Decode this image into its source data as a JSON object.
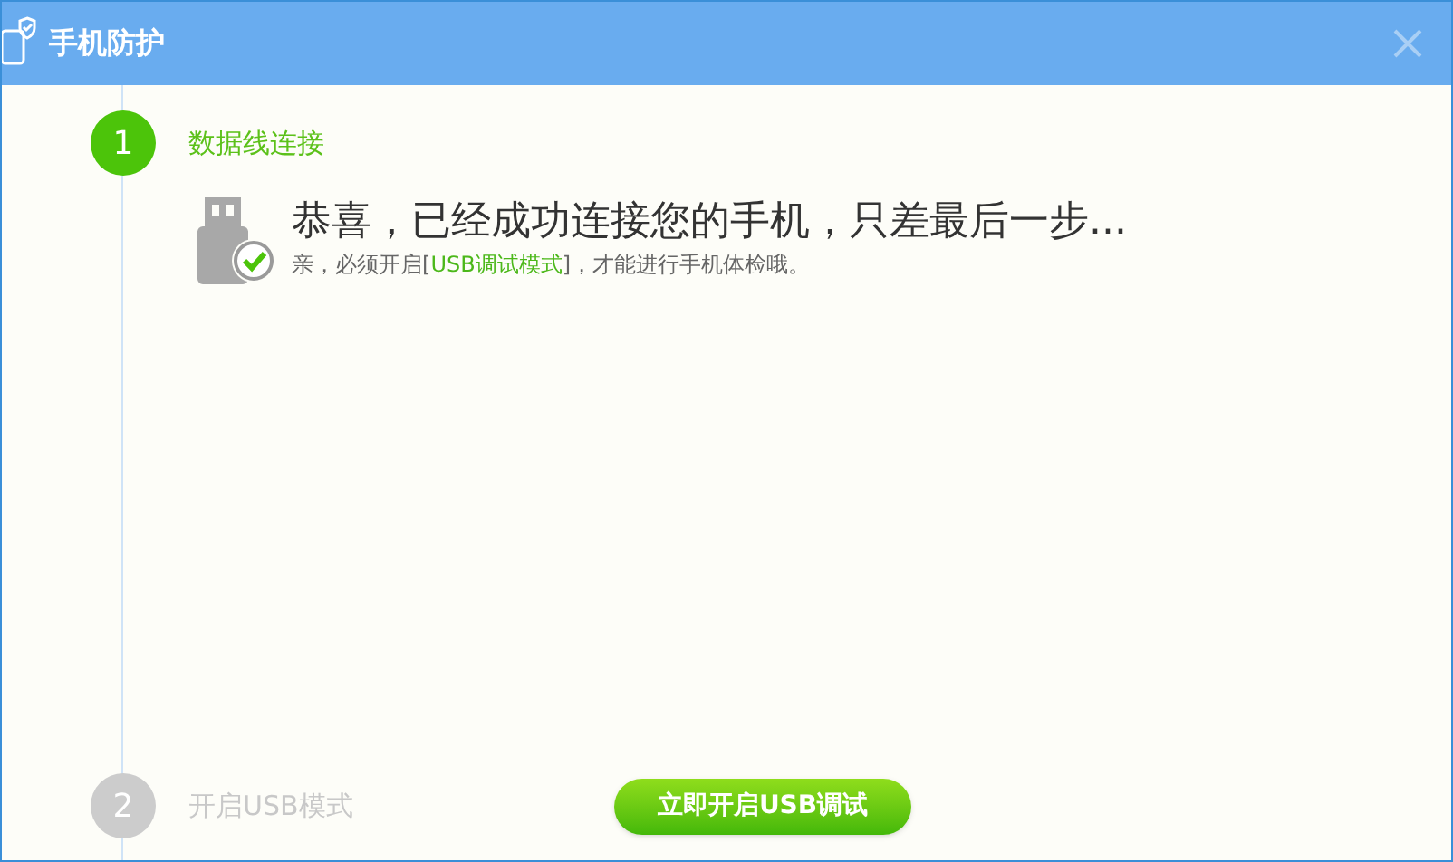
{
  "window": {
    "title": "手机防护"
  },
  "steps": [
    {
      "number": "1",
      "label": "数据线连接",
      "active": true
    },
    {
      "number": "2",
      "label": "开启USB模式",
      "active": false
    }
  ],
  "message": {
    "headline": "恭喜，已经成功连接您的手机，只差最后一步...",
    "note_before": "亲，必须开启[",
    "note_link": "USB调试模式",
    "note_after": "]，才能进行手机体检哦。"
  },
  "button": {
    "label": "立即开启USB调试"
  }
}
